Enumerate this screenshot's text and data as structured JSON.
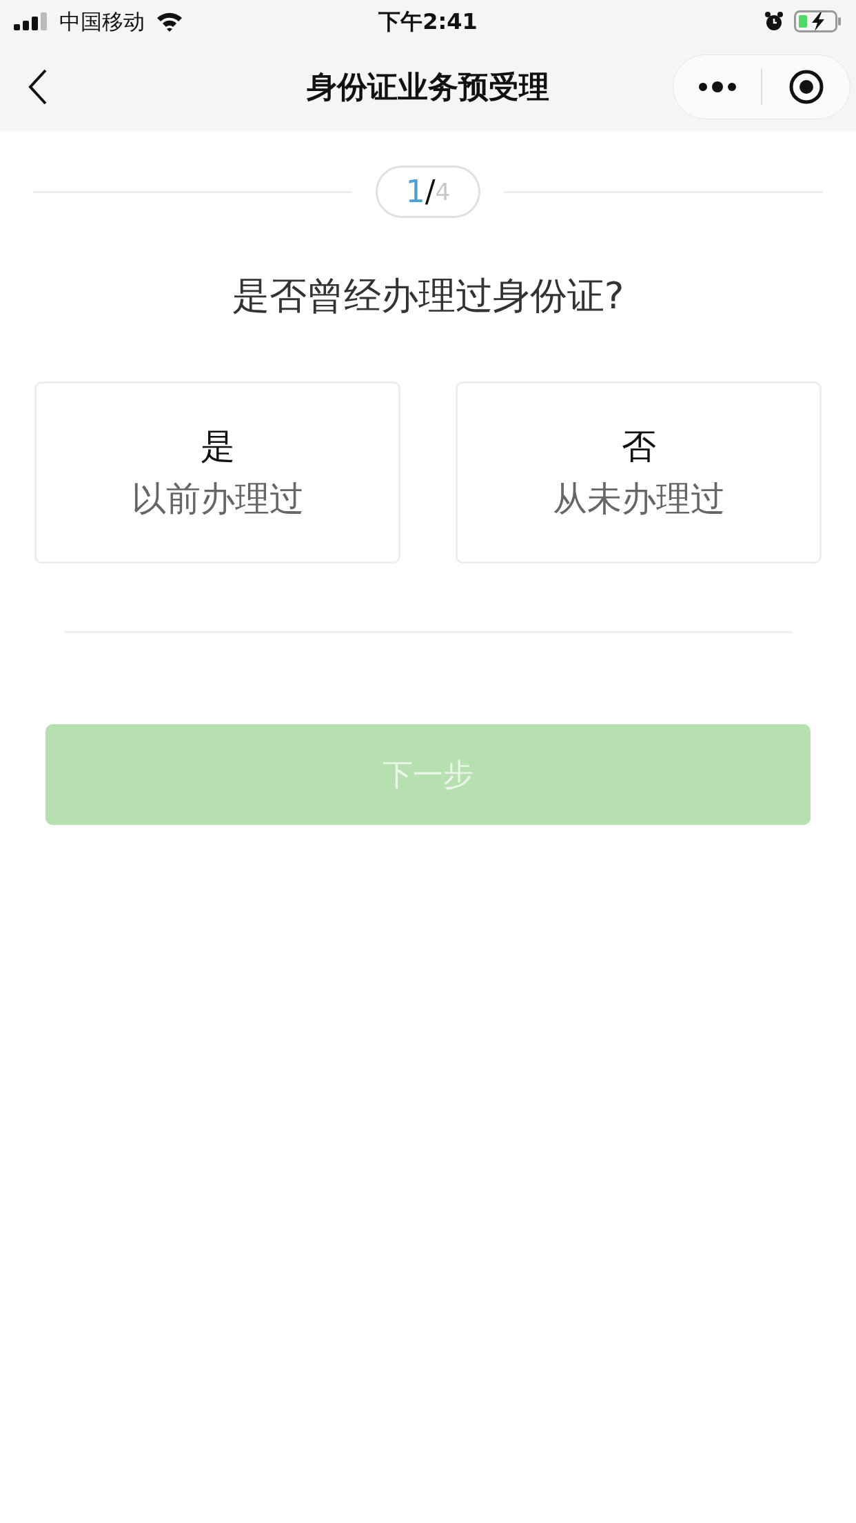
{
  "status_bar": {
    "carrier": "中国移动",
    "time": "下午2:41"
  },
  "nav_bar": {
    "title": "身份证业务预受理"
  },
  "step": {
    "current": "1",
    "separator": "/",
    "total": "4"
  },
  "question": "是否曾经办理过身份证?",
  "options": [
    {
      "label": "是",
      "description": "以前办理过",
      "selected": false
    },
    {
      "label": "否",
      "description": "从未办理过",
      "selected": false
    }
  ],
  "next_button": {
    "label": "下一步",
    "disabled": true
  }
}
